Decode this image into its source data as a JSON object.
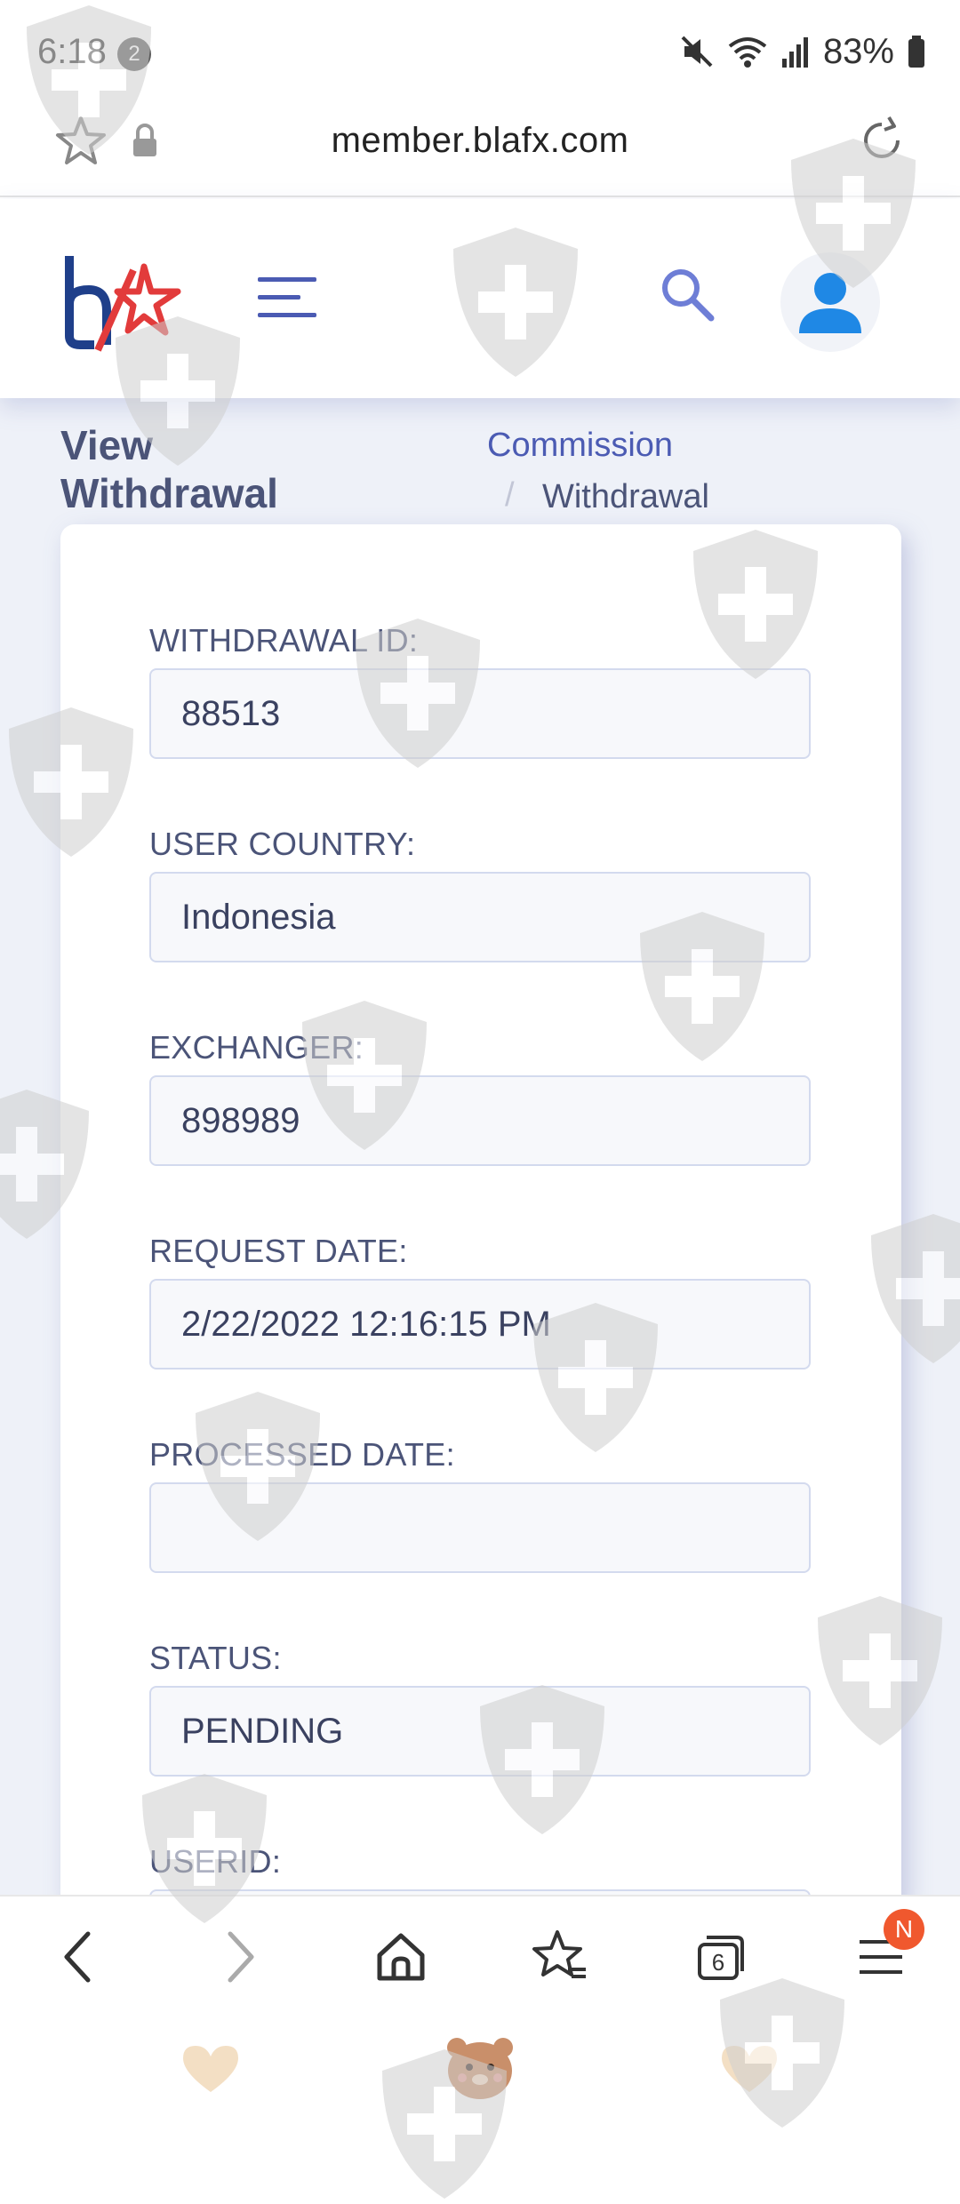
{
  "status_bar": {
    "time": "6:18",
    "notification_count": "2",
    "battery_text": "83%",
    "icons": [
      "mute-icon",
      "wifi-icon",
      "signal-icon",
      "battery-icon"
    ]
  },
  "browser": {
    "url": "member.blafx.com",
    "icons": [
      "star-icon",
      "lock-icon",
      "reload-icon"
    ]
  },
  "header": {
    "icons": [
      "logo",
      "menu-icon",
      "search-icon",
      "user-icon"
    ],
    "accent_color": "#4b5bb3"
  },
  "page": {
    "title_line1": "View",
    "title_line2": "Withdrawal",
    "breadcrumb": [
      "Commission",
      "Withdrawal"
    ],
    "breadcrumb_separator": "/"
  },
  "fields": [
    {
      "label": "WITHDRAWAL ID:",
      "value": "88513"
    },
    {
      "label": "USER COUNTRY:",
      "value": "Indonesia"
    },
    {
      "label": "EXCHANGER:",
      "value": "898989"
    },
    {
      "label": "REQUEST DATE:",
      "value": "2/22/2022 12:16:15 PM"
    },
    {
      "label": "PROCESSED DATE:",
      "value": ""
    },
    {
      "label": "STATUS:",
      "value": "PENDING"
    },
    {
      "label": "USERID:",
      "value": ""
    }
  ],
  "bottom_nav": {
    "tabs_count": "6",
    "menu_badge": "N",
    "icons": [
      "back-icon",
      "forward-icon",
      "home-icon",
      "bookmarks-icon",
      "tabs-icon",
      "menu-icon"
    ]
  },
  "gesture_icons": [
    "heart-icon",
    "bear-icon",
    "heart-icon"
  ]
}
